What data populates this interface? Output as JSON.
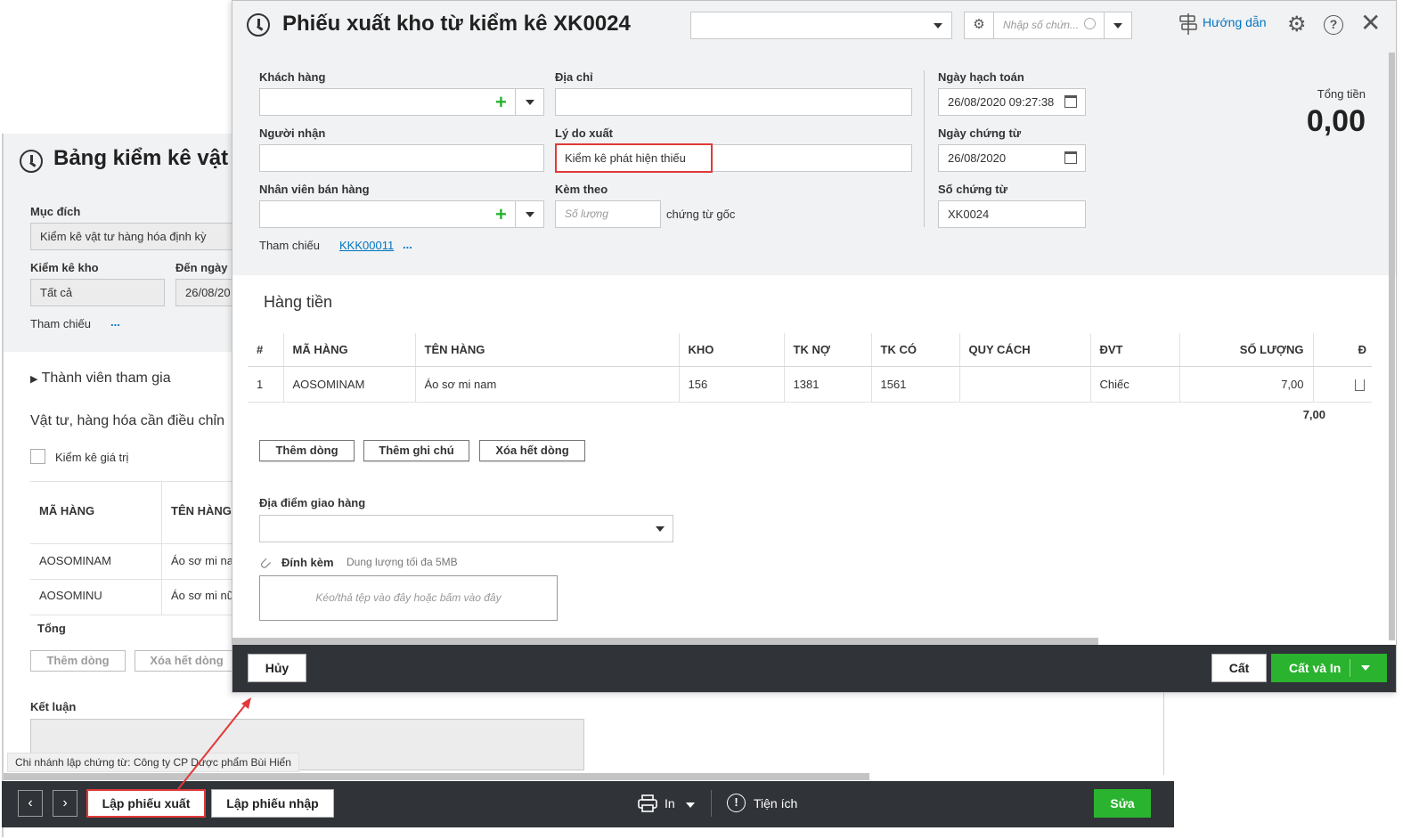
{
  "background_window": {
    "title": "Bảng kiểm kê vật",
    "purpose_label": "Mục đích",
    "purpose_value": "Kiểm kê vật tư hàng hóa định kỳ",
    "warehouse_label": "Kiểm kê kho",
    "warehouse_value": "Tất cả",
    "to_date_label": "Đến ngày",
    "to_date_value": "26/08/20",
    "reference_label": "Tham chiếu",
    "reference_more": "...",
    "members_label": "Thành viên tham gia",
    "adjust_label": "Vật tư, hàng hóa cần điều chỉn",
    "value_check_label": "Kiểm kê giá trị",
    "table": {
      "headers": [
        "MÃ HÀNG",
        "TÊN HÀNG"
      ],
      "rows": [
        [
          "AOSOMINAM",
          "Áo sơ mi na"
        ],
        [
          "AOSOMINU",
          "Áo sơ mi nữ"
        ]
      ],
      "total_label": "Tổng"
    },
    "add_row_label": "Thêm dòng",
    "delete_all_label": "Xóa hết dòng",
    "conclusion_label": "Kết luận",
    "branch_text": "Chi nhánh lập chứng từ: Công ty CP Dược phẩm Bùi Hiển",
    "bottom": {
      "prev": "‹",
      "next": "›",
      "create_export": "Lập phiếu xuất",
      "create_import": "Lập phiếu nhập",
      "print": "In",
      "utilities": "Tiện ích",
      "edit": "Sửa"
    }
  },
  "dialog": {
    "title": "Phiếu xuất kho từ kiểm kê XK0024",
    "search_placeholder": "Nhập số chứn...",
    "guide_label": "Hướng dẫn",
    "customer_label": "Khách hàng",
    "address_label": "Địa chỉ",
    "receiver_label": "Người nhận",
    "reason_label": "Lý do xuất",
    "reason_value": "Kiểm kê phát hiện thiếu",
    "salesperson_label": "Nhân viên bán hàng",
    "attached_label": "Kèm theo",
    "quantity_placeholder": "Số lượng",
    "original_docs_label": "chứng từ gốc",
    "reference_label": "Tham chiếu",
    "reference_link": "KKK00011",
    "reference_more": "...",
    "posting_date_label": "Ngày hạch toán",
    "posting_date_value": "26/08/2020 09:27:38",
    "doc_date_label": "Ngày chứng từ",
    "doc_date_value": "26/08/2020",
    "doc_no_label": "Số chứng từ",
    "doc_no_value": "XK0024",
    "total_label": "Tổng tiền",
    "total_value": "0,00",
    "section_title": "Hàng tiền",
    "table": {
      "headers": [
        "#",
        "MÃ HÀNG",
        "TÊN HÀNG",
        "KHO",
        "TK NỢ",
        "TK CÓ",
        "QUY CÁCH",
        "ĐVT",
        "SỐ LƯỢNG",
        "Đ"
      ],
      "rows": [
        [
          "1",
          "AOSOMINAM",
          "Áo sơ mi nam",
          "156",
          "1381",
          "1561",
          "",
          "Chiếc",
          "7,00"
        ]
      ],
      "total_quantity": "7,00"
    },
    "add_row_label": "Thêm dòng",
    "add_note_label": "Thêm ghi chú",
    "delete_all_label": "Xóa hết dòng",
    "delivery_label": "Địa điểm giao hàng",
    "attach_label": "Đính kèm",
    "attach_limit": "Dung lượng tối đa 5MB",
    "drop_hint": "Kéo/thả tệp vào đây hoặc bấm vào đây",
    "cancel_label": "Hủy",
    "save_label": "Cất",
    "save_print_label": "Cất và In"
  },
  "colors": {
    "accent_green": "#2ab32e",
    "highlight_red": "#e03a3a",
    "link_blue": "#0075c0",
    "dark_bar": "#303338"
  }
}
